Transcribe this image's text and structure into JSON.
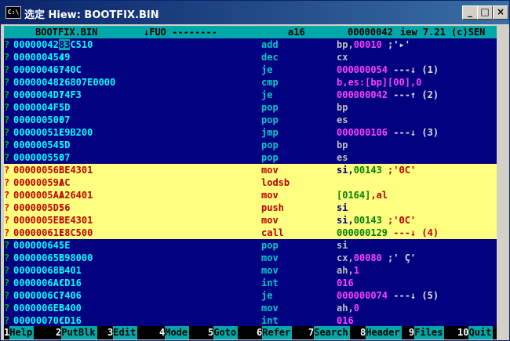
{
  "window": {
    "title": "选定 Hiew: BOOTFIX.BIN",
    "icon_name": "console-icon",
    "icon_text": "C:\\",
    "buttons": {
      "minimize": "_",
      "maximize": "□",
      "close": "×"
    }
  },
  "header": {
    "filename": "BOOTFIX.BIN",
    "mode": "↓FUO --------",
    "bitness": "a16",
    "offset": "00000042",
    "version": "Hiew 7.21 (c)SEN",
    "version_partial": "iew 7.21 (c)SEN"
  },
  "rows": [
    {
      "mark": "?",
      "addr": "00000042:",
      "bytes_cursor": "83",
      "bytes_rest": "C510",
      "mn": "add",
      "op1": "bp,",
      "op2": "00010",
      "op3": " ;'▸'",
      "highlight": false
    },
    {
      "mark": "?",
      "addr": "00000045:",
      "bytes_cursor": "",
      "bytes_rest": "49",
      "mn": "dec",
      "op1": "cx",
      "op2": "",
      "op3": "",
      "highlight": false
    },
    {
      "mark": "?",
      "addr": "00000046:",
      "bytes_cursor": "",
      "bytes_rest": "740C",
      "mn": "je",
      "op1": "",
      "op2": "000000054",
      "op3": " ---↓ (1)",
      "highlight": false
    },
    {
      "mark": "?",
      "addr": "00000048:",
      "bytes_cursor": "",
      "bytes_rest": "26807E0000",
      "mn": "cmp",
      "op1": "",
      "op2": "b,es:[bp][00],0",
      "op3": "",
      "highlight": false
    },
    {
      "mark": "?",
      "addr": "0000004D:",
      "bytes_cursor": "",
      "bytes_rest": "74F3",
      "mn": "je",
      "op1": "",
      "op2": "000000042",
      "op3": " ---↑ (2)",
      "highlight": false
    },
    {
      "mark": "?",
      "addr": "0000004F:",
      "bytes_cursor": "",
      "bytes_rest": "5D",
      "mn": "pop",
      "op1": "bp",
      "op2": "",
      "op3": "",
      "highlight": false
    },
    {
      "mark": "?",
      "addr": "00000050:",
      "bytes_cursor": "",
      "bytes_rest": "07",
      "mn": "pop",
      "op1": "es",
      "op2": "",
      "op3": "",
      "highlight": false
    },
    {
      "mark": "?",
      "addr": "00000051:",
      "bytes_cursor": "",
      "bytes_rest": "E9B200",
      "mn": "jmp",
      "op1": "",
      "op2": "000000106",
      "op3": " ---↓ (3)",
      "highlight": false
    },
    {
      "mark": "?",
      "addr": "00000054:",
      "bytes_cursor": "",
      "bytes_rest": "5D",
      "mn": "pop",
      "op1": "bp",
      "op2": "",
      "op3": "",
      "highlight": false
    },
    {
      "mark": "?",
      "addr": "00000055:",
      "bytes_cursor": "",
      "bytes_rest": "07",
      "mn": "pop",
      "op1": "es",
      "op2": "",
      "op3": "",
      "highlight": false
    },
    {
      "mark": "?",
      "addr": "00000056:",
      "bytes_cursor": "",
      "bytes_rest": "BE4301",
      "mn": "mov",
      "op1": "si,",
      "op2": "00143",
      "op3": " ;'ΘC'",
      "highlight": true
    },
    {
      "mark": "?",
      "addr": "00000059:",
      "bytes_cursor": "",
      "bytes_rest": "AC",
      "mn": "lodsb",
      "op1": "",
      "op2": "",
      "op3": "",
      "highlight": true
    },
    {
      "mark": "?",
      "addr": "0000005A:",
      "bytes_cursor": "",
      "bytes_rest": "A26401",
      "mn": "mov",
      "op1": "",
      "op2": "[0164]",
      "op3": ",al",
      "highlight": true
    },
    {
      "mark": "?",
      "addr": "0000005D:",
      "bytes_cursor": "",
      "bytes_rest": "56",
      "mn": "push",
      "op1": "si",
      "op2": "",
      "op3": "",
      "highlight": true
    },
    {
      "mark": "?",
      "addr": "0000005E:",
      "bytes_cursor": "",
      "bytes_rest": "BE4301",
      "mn": "mov",
      "op1": "si,",
      "op2": "00143",
      "op3": " ;'ΘC'",
      "highlight": true
    },
    {
      "mark": "?",
      "addr": "00000061:",
      "bytes_cursor": "",
      "bytes_rest": "E8C500",
      "mn": "call",
      "op1": "",
      "op2": "000000129",
      "op3": " ---↓ (4)",
      "highlight": true
    },
    {
      "mark": "?",
      "addr": "00000064:",
      "bytes_cursor": "",
      "bytes_rest": "5E",
      "mn": "pop",
      "op1": "si",
      "op2": "",
      "op3": "",
      "highlight": false
    },
    {
      "mark": "?",
      "addr": "00000065:",
      "bytes_cursor": "",
      "bytes_rest": "B98000",
      "mn": "mov",
      "op1": "cx,",
      "op2": "00080",
      "op3": " ;' Ç'",
      "highlight": false
    },
    {
      "mark": "?",
      "addr": "00000068:",
      "bytes_cursor": "",
      "bytes_rest": "B401",
      "mn": "mov",
      "op1": "ah,",
      "op2": "1",
      "op3": "",
      "highlight": false
    },
    {
      "mark": "?",
      "addr": "0000006A:",
      "bytes_cursor": "",
      "bytes_rest": "CD16",
      "mn": "int",
      "op1": "",
      "op2": "016",
      "op3": "",
      "highlight": false
    },
    {
      "mark": "?",
      "addr": "0000006C:",
      "bytes_cursor": "",
      "bytes_rest": "7406",
      "mn": "je",
      "op1": "",
      "op2": "000000074",
      "op3": " ---↓ (5)",
      "highlight": false
    },
    {
      "mark": "?",
      "addr": "0000006E:",
      "bytes_cursor": "",
      "bytes_rest": "B400",
      "mn": "mov",
      "op1": "ah,",
      "op2": "0",
      "op3": "",
      "highlight": false
    },
    {
      "mark": "?",
      "addr": "00000070:",
      "bytes_cursor": "",
      "bytes_rest": "CD16",
      "mn": "int",
      "op1": "",
      "op2": "016",
      "op3": "",
      "highlight": false
    }
  ],
  "fkeys": [
    {
      "num": "1",
      "label": "Help"
    },
    {
      "num": "2",
      "label": "PutBlk"
    },
    {
      "num": "3",
      "label": "Edit"
    },
    {
      "num": "4",
      "label": "Mode"
    },
    {
      "num": "5",
      "label": "Goto"
    },
    {
      "num": "6",
      "label": "Refer"
    },
    {
      "num": "7",
      "label": "Search"
    },
    {
      "num": "8",
      "label": "Header"
    },
    {
      "num": "9",
      "label": "Files"
    },
    {
      "num": "10",
      "label": "Quit"
    }
  ]
}
